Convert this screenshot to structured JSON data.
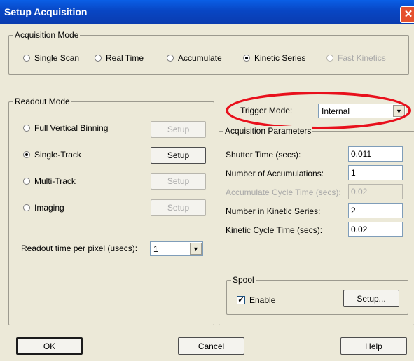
{
  "window": {
    "title": "Setup Acquisition",
    "close_glyph": "✕"
  },
  "acquisition_mode": {
    "label": "Acquisition Mode",
    "options": [
      {
        "label": "Single Scan",
        "selected": false,
        "enabled": true
      },
      {
        "label": "Real Time",
        "selected": false,
        "enabled": true
      },
      {
        "label": "Accumulate",
        "selected": false,
        "enabled": true
      },
      {
        "label": "Kinetic Series",
        "selected": true,
        "enabled": true
      },
      {
        "label": "Fast Kinetics",
        "selected": false,
        "enabled": false
      }
    ]
  },
  "readout_mode": {
    "label": "Readout Mode",
    "options": [
      {
        "label": "Full Vertical Binning",
        "selected": false,
        "setup": "Setup",
        "setup_enabled": false
      },
      {
        "label": "Single-Track",
        "selected": true,
        "setup": "Setup",
        "setup_enabled": true
      },
      {
        "label": "Multi-Track",
        "selected": false,
        "setup": "Setup",
        "setup_enabled": false
      },
      {
        "label": "Imaging",
        "selected": false,
        "setup": "Setup",
        "setup_enabled": false
      }
    ],
    "readout_time_label": "Readout time per pixel (usecs):",
    "readout_time_value": "1"
  },
  "trigger": {
    "label": "Trigger Mode:",
    "value": "Internal"
  },
  "acquisition_params": {
    "label": "Acquisition Parameters",
    "shutter_label": "Shutter Time (secs):",
    "shutter_value": "0.011",
    "num_acc_label": "Number of Accumulations:",
    "num_acc_value": "1",
    "acc_cycle_label": "Accumulate Cycle Time (secs):",
    "acc_cycle_value": "0.02",
    "num_kinetic_label": "Number in Kinetic Series:",
    "num_kinetic_value": "2",
    "kinetic_cycle_label": "Kinetic Cycle Time (secs):",
    "kinetic_cycle_value": "0.02"
  },
  "spool": {
    "label": "Spool",
    "enable_label": "Enable",
    "enabled": true,
    "setup_label": "Setup..."
  },
  "footer": {
    "ok": "OK",
    "cancel": "Cancel",
    "help": "Help"
  },
  "colors": {
    "titlebar": "#0846c4",
    "highlight_ellipse": "#e8101c",
    "dialog_bg": "#ece9d8"
  }
}
